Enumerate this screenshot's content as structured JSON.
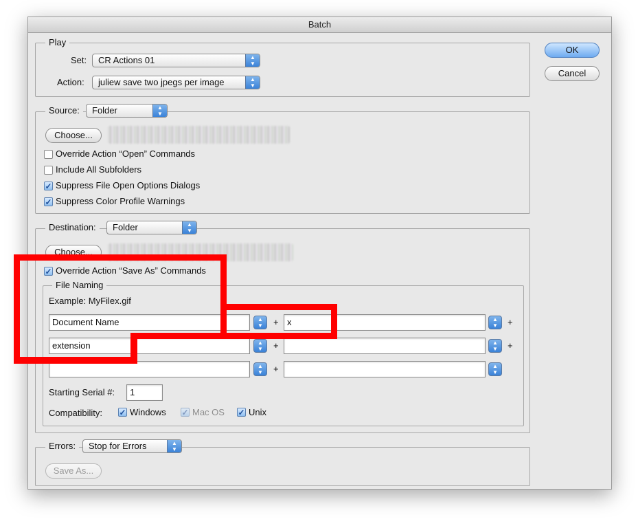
{
  "window": {
    "title": "Batch"
  },
  "buttons": {
    "ok": "OK",
    "cancel": "Cancel"
  },
  "play": {
    "group_label": "Play",
    "set_label": "Set:",
    "set_value": "CR Actions 01",
    "action_label": "Action:",
    "action_value": "juliew save two jpegs per image"
  },
  "source": {
    "label": "Source:",
    "value": "Folder",
    "choose": "Choose...",
    "checkboxes": [
      {
        "label": "Override Action “Open” Commands",
        "checked": false
      },
      {
        "label": "Include All Subfolders",
        "checked": false
      },
      {
        "label": "Suppress File Open Options Dialogs",
        "checked": true
      },
      {
        "label": "Suppress Color Profile Warnings",
        "checked": true
      }
    ]
  },
  "destination": {
    "label": "Destination:",
    "value": "Folder",
    "choose": "Choose...",
    "override_save_as": {
      "label": "Override Action “Save As” Commands",
      "checked": true
    },
    "file_naming": {
      "label": "File Naming",
      "example": "Example: MyFilex.gif",
      "rows": [
        {
          "left": "Document Name",
          "right": "x"
        },
        {
          "left": "extension",
          "right": ""
        },
        {
          "left": "",
          "right": ""
        }
      ],
      "plus": "+",
      "serial_label": "Starting Serial #:",
      "serial_value": "1",
      "compat_label": "Compatibility:",
      "compat": [
        {
          "label": "Windows",
          "checked": true,
          "enabled": true
        },
        {
          "label": "Mac OS",
          "checked": true,
          "enabled": false
        },
        {
          "label": "Unix",
          "checked": true,
          "enabled": true
        }
      ]
    }
  },
  "errors": {
    "label": "Errors:",
    "value": "Stop for Errors",
    "save_as": "Save As..."
  },
  "colors": {
    "highlight": "#ff0000",
    "accent": "#3a82d8"
  }
}
